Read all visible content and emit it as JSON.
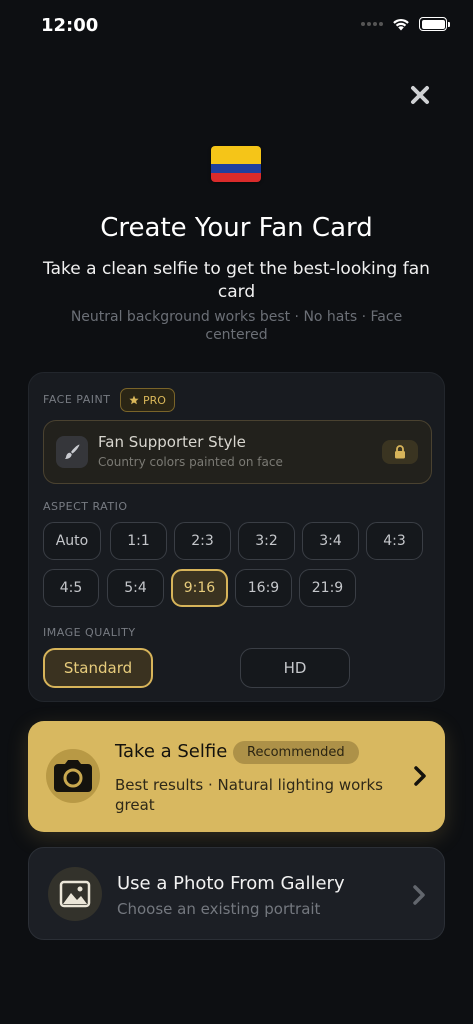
{
  "status_bar": {
    "time": "12:00"
  },
  "header": {
    "flag_emoji": "colombia-flag",
    "title": "Create Your Fan Card",
    "subtitle": "Take a clean selfie to get the best-looking fan card",
    "hint": "Neutral background works best · No hats · Face centered"
  },
  "face_paint": {
    "label": "FACE PAINT",
    "badge": "PRO",
    "style_name": "Fan Supporter Style",
    "style_desc": "Country colors painted on face"
  },
  "aspect_ratio": {
    "label": "ASPECT RATIO",
    "options": [
      "Auto",
      "1:1",
      "2:3",
      "3:2",
      "3:4",
      "4:3",
      "4:5",
      "5:4",
      "9:16",
      "16:9",
      "21:9"
    ],
    "selected": "9:16"
  },
  "image_quality": {
    "label": "IMAGE QUALITY",
    "options": [
      "Standard",
      "HD"
    ],
    "selected": "Standard"
  },
  "selfie": {
    "title": "Take a Selfie",
    "badge": "Recommended",
    "desc": "Best results · Natural lighting works great"
  },
  "gallery": {
    "title": "Use a Photo From Gallery",
    "desc": "Choose an existing portrait"
  },
  "colors": {
    "accent": "#d8b860",
    "background": "#0d0f12",
    "panel": "#181b20"
  }
}
